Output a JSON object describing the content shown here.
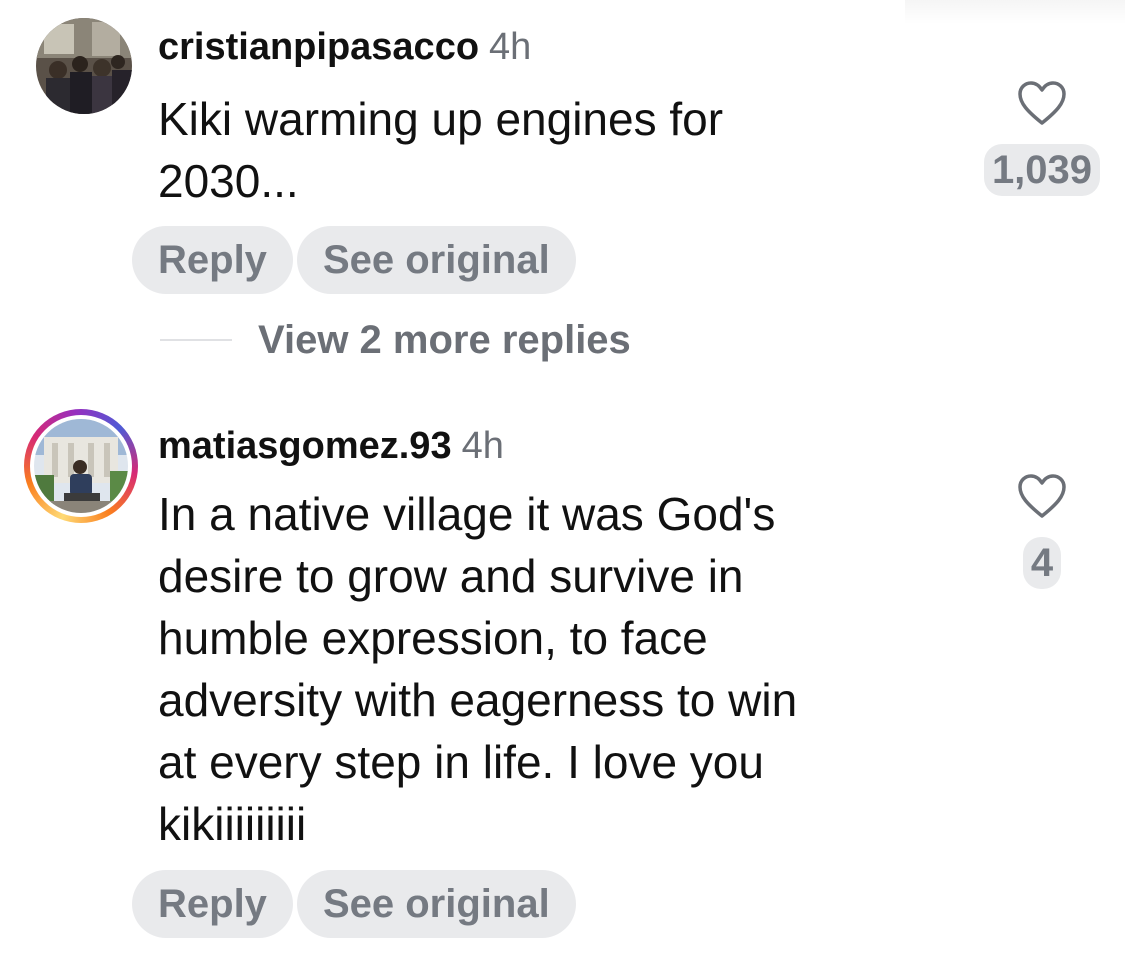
{
  "comments": [
    {
      "username": "cristianpipasacco",
      "time": "4h",
      "text": "Kiki warming up engines for\n2030...",
      "likes": "1,039",
      "actions": {
        "reply": "Reply",
        "see_original": "See original"
      },
      "avatar_story_ring": false,
      "view_replies": "View 2 more replies"
    },
    {
      "username": "matiasgomez.93",
      "time": "4h",
      "text": "In a native village it was God's\ndesire to grow and survive in\nhumble expression, to face\nadversity with eagerness to win\nat every step in life. I love you\nkikiiiiiiiii",
      "likes": "4",
      "actions": {
        "reply": "Reply",
        "see_original": "See original"
      },
      "avatar_story_ring": true
    }
  ],
  "icons": {
    "like": "heart-outline-icon"
  },
  "colors": {
    "text": "#111111",
    "secondary_text": "#6b6f76",
    "pill_background": "#e9eaec",
    "pill_text": "#757a82",
    "story_ring": [
      "#feda75",
      "#fa7e1e",
      "#d62976",
      "#962fbf",
      "#4f5bd5"
    ]
  }
}
